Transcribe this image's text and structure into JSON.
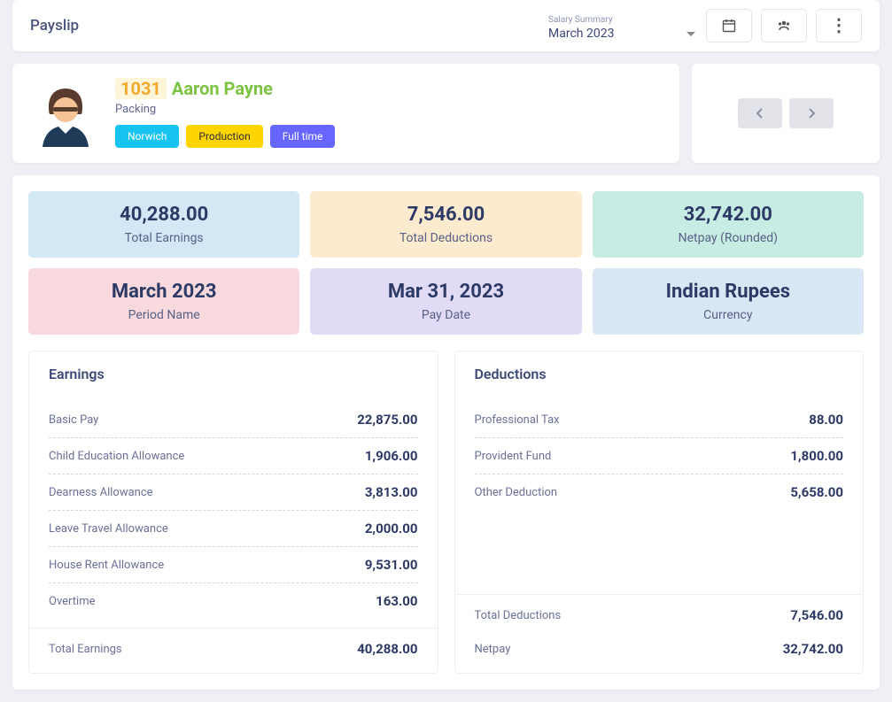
{
  "header": {
    "title": "Payslip",
    "period_label": "Salary Summary",
    "period_value": "March 2023"
  },
  "employee": {
    "id": "1031",
    "name": "Aaron Payne",
    "department": "Packing",
    "tags": {
      "location": "Norwich",
      "division": "Production",
      "type": "Full time"
    }
  },
  "kpis": {
    "total_earnings": {
      "value": "40,288.00",
      "label": "Total Earnings"
    },
    "total_deductions": {
      "value": "7,546.00",
      "label": "Total Deductions"
    },
    "netpay": {
      "value": "32,742.00",
      "label": "Netpay (Rounded)"
    },
    "period": {
      "value": "March 2023",
      "label": "Period Name"
    },
    "paydate": {
      "value": "Mar 31, 2023",
      "label": "Pay Date"
    },
    "currency": {
      "value": "Indian Rupees",
      "label": "Currency"
    }
  },
  "earnings": {
    "title": "Earnings",
    "items": [
      {
        "label": "Basic Pay",
        "value": "22,875.00"
      },
      {
        "label": "Child Education Allowance",
        "value": "1,906.00"
      },
      {
        "label": "Dearness Allowance",
        "value": "3,813.00"
      },
      {
        "label": "Leave Travel Allowance",
        "value": "2,000.00"
      },
      {
        "label": "House Rent Allowance",
        "value": "9,531.00"
      },
      {
        "label": "Overtime",
        "value": "163.00"
      }
    ],
    "total": {
      "label": "Total Earnings",
      "value": "40,288.00"
    }
  },
  "deductions": {
    "title": "Deductions",
    "items": [
      {
        "label": "Professional Tax",
        "value": "88.00"
      },
      {
        "label": "Provident Fund",
        "value": "1,800.00"
      },
      {
        "label": "Other Deduction",
        "value": "5,658.00"
      }
    ],
    "total": {
      "label": "Total Deductions",
      "value": "7,546.00"
    },
    "netpay": {
      "label": "Netpay",
      "value": "32,742.00"
    }
  }
}
